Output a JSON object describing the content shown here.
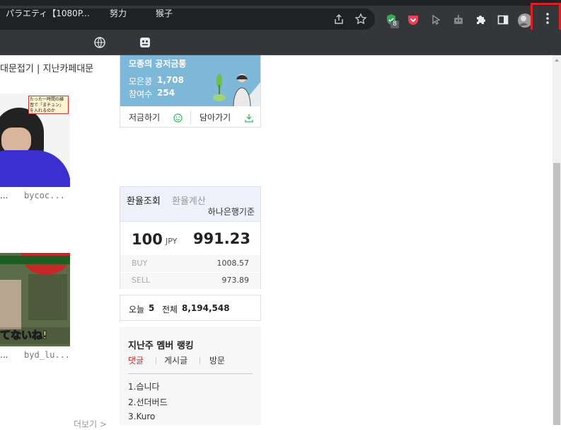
{
  "browser": {
    "extension_badge": "8",
    "bookmarks": [
      {
        "label": "パラエティ【1080P..."
      },
      {
        "label": "努力"
      },
      {
        "label": "猴子"
      }
    ],
    "highlight_color": "#e02020"
  },
  "left_content": {
    "top_links": "대문접기 | 지난카페대문",
    "posts": [
      {
        "title": "...",
        "author": "bycoc...",
        "thumb_text": "たった一時間の練習で「まチュン」を入れるのか"
      },
      {
        "title": "...",
        "author": "byd_lu...",
        "thumb_text": "てないね!"
      }
    ],
    "more_link": "더보기 >"
  },
  "savings_widget": {
    "title": "모종의 공저금통",
    "collected_label": "모은콩",
    "collected_value": "1,708",
    "participants_label": "참여수",
    "participants_value": "254",
    "save_button": "저금하기",
    "take_button": "담아가기"
  },
  "exchange_widget": {
    "tab_lookup": "환율조회",
    "tab_calc": "환율계산",
    "basis": "하나은행기준",
    "amount": "100",
    "currency": "JPY",
    "rate": "991.23",
    "buy_label": "BUY",
    "buy_value": "1008.57",
    "sell_label": "SELL",
    "sell_value": "973.89"
  },
  "visitor_widget": {
    "today_label": "오늘",
    "today_value": "5",
    "total_label": "전체",
    "total_value": "8,194,548"
  },
  "ranking_widget": {
    "title": "지난주 멤버 랭킹",
    "tabs": [
      "댓글",
      "게시글",
      "방문"
    ],
    "items": [
      "1.습니다",
      "2.선더버드",
      "3.Kuro"
    ]
  }
}
